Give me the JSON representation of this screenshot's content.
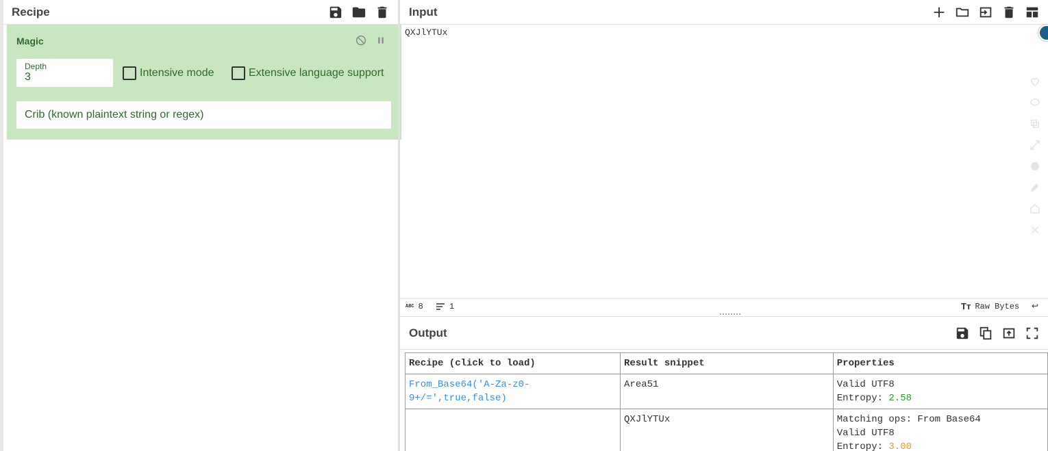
{
  "recipe": {
    "title": "Recipe",
    "operation": {
      "name": "Magic",
      "depth_label": "Depth",
      "depth_value": "3",
      "intensive_label": "Intensive mode",
      "extensive_label": "Extensive language support",
      "crib_placeholder": "Crib (known plaintext string or regex)"
    }
  },
  "input": {
    "title": "Input",
    "text": "QXJlYTUx",
    "status": {
      "length_icon": "abc-icon",
      "length": "8",
      "lines": "1",
      "encoding": "Raw Bytes"
    }
  },
  "output": {
    "title": "Output",
    "headers": [
      "Recipe (click to load)",
      "Result snippet",
      "Properties"
    ],
    "rows": [
      {
        "recipe": "From_Base64('A-Za-z0-9+/=',true,false)",
        "recipe_line1": "From_Base64('A-Za-z0-",
        "recipe_line2": "9+/=',true,false)",
        "snippet": "Area51",
        "prop1": "Valid UTF8",
        "entropy_label": "Entropy: ",
        "entropy": "2.58"
      },
      {
        "recipe": "",
        "snippet": "QXJlYTUx",
        "prop_match": "Matching ops: From Base64",
        "prop1": "Valid UTF8",
        "entropy_label": "Entropy: ",
        "entropy": "3.00"
      }
    ]
  },
  "colors": {
    "op_background": "#c8e6c0",
    "op_text": "#2e6a2e",
    "link": "#3b8fd8",
    "entropy_good": "#2a9a2a",
    "entropy_warn": "#e0a020"
  }
}
